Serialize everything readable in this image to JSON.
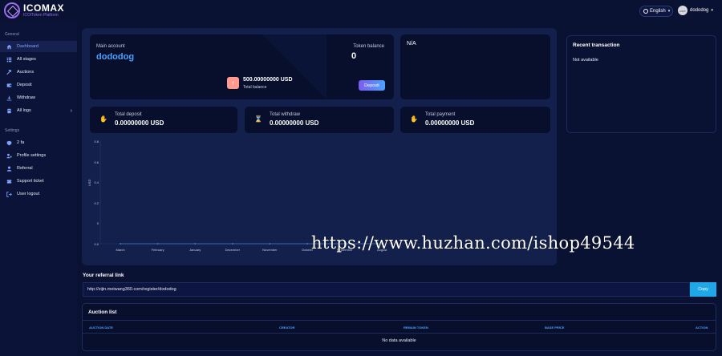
{
  "brand": {
    "name": "ICOMAX",
    "subtitle": "ICO/Token Platform"
  },
  "header": {
    "language": "English",
    "username": "dododog",
    "avatar_text": "user"
  },
  "sidebar": {
    "general_label": "General",
    "general_items": [
      {
        "label": "Dashboard",
        "icon": "home-icon",
        "active": true
      },
      {
        "label": "All stages",
        "icon": "list-icon"
      },
      {
        "label": "Auctions",
        "icon": "gavel-icon"
      },
      {
        "label": "Deposit",
        "icon": "wallet-icon"
      },
      {
        "label": "Withdraw",
        "icon": "download-icon"
      },
      {
        "label": "All logs",
        "icon": "book-icon",
        "has_submenu": true
      }
    ],
    "settings_label": "Settings",
    "settings_items": [
      {
        "label": "2 fa",
        "icon": "shield-icon"
      },
      {
        "label": "Profile settings",
        "icon": "users-cog-icon"
      },
      {
        "label": "Referral",
        "icon": "user-icon"
      },
      {
        "label": "Support ticket",
        "icon": "ticket-icon"
      },
      {
        "label": "User logout",
        "icon": "logout-icon"
      }
    ]
  },
  "account": {
    "main_label": "Main account",
    "username": "dododog",
    "token_label": "Token balance",
    "token_value": "0",
    "balance_value": "500.00000000 USD",
    "balance_label": "Total balance",
    "deposit_button": "Deposit"
  },
  "na_card": {
    "text": "N/A"
  },
  "stats": {
    "deposit": {
      "label": "Total deposit",
      "value": "0.00000000 USD"
    },
    "withdraw": {
      "label": "Total withdraw",
      "value": "0.00000000 USD"
    },
    "payment": {
      "label": "Total payment",
      "value": "0.00000000 USD"
    }
  },
  "chart_data": {
    "type": "line",
    "ylabel": "USD",
    "ylim": [
      0,
      0.8
    ],
    "yticks": [
      "0.8",
      "0.6",
      "0.4",
      "0.2",
      "0",
      "0.0"
    ],
    "categories": [
      "March",
      "February",
      "January",
      "December",
      "November",
      "October",
      "September",
      "August"
    ],
    "series": [
      {
        "values": [
          0,
          0,
          0,
          0,
          0,
          0,
          0,
          0
        ]
      }
    ]
  },
  "watermark": "https://www.huzhan.com/ishop49544",
  "recent": {
    "title": "Recent transaction",
    "empty": "Not available"
  },
  "referral": {
    "title": "Your referral link",
    "link": "http://zijin.meiwang360.com/register/dododog",
    "copy_button": "Copy"
  },
  "auction": {
    "title": "Auction list",
    "columns": [
      "AUCTION DATE",
      "CREATOR",
      "REMAIN TOKEN",
      "BASE PRICE",
      "ACTION"
    ],
    "empty": "No data available"
  },
  "colors": {
    "accent": "#4aa3ff",
    "background": "#0a1233",
    "card": "#070f2c",
    "copy": "#1fa8e8"
  }
}
